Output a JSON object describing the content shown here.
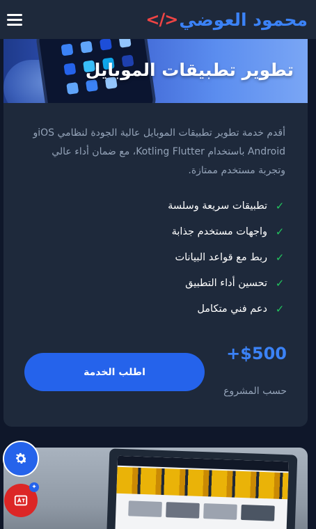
{
  "header": {
    "brand_name": "محمود العوضي",
    "brand_code_symbol": "</>"
  },
  "service": {
    "title": "تطوير تطبيقات الموبايل",
    "description": "أقدم خدمة تطوير تطبيقات الموبايل عالية الجودة لنظامي iOSو Android باستخدام Kotling Flutter، مع ضمان أداء عالي وتجربة مستخدم ممتازة.",
    "features": [
      "تطبيقات سريعة وسلسة",
      "واجهات مستخدم جذابة",
      "ربط مع قواعد البيانات",
      "تحسين أداء التطبيق",
      "دعم فني متكامل"
    ],
    "price": "+$500",
    "price_note": "حسب المشروع",
    "order_button": "اطلب الخدمة"
  },
  "icons": {
    "menu": "menu-icon",
    "check": "check-icon",
    "settings": "gear-icon",
    "translate": "translate-icon"
  },
  "colors": {
    "background": "#0f172a",
    "card": "#1e293b",
    "accent": "#2563eb",
    "brand_blue": "#3b82f6",
    "brand_red": "#ef4444",
    "check_green": "#22c55e",
    "translate_red": "#dc2626"
  }
}
